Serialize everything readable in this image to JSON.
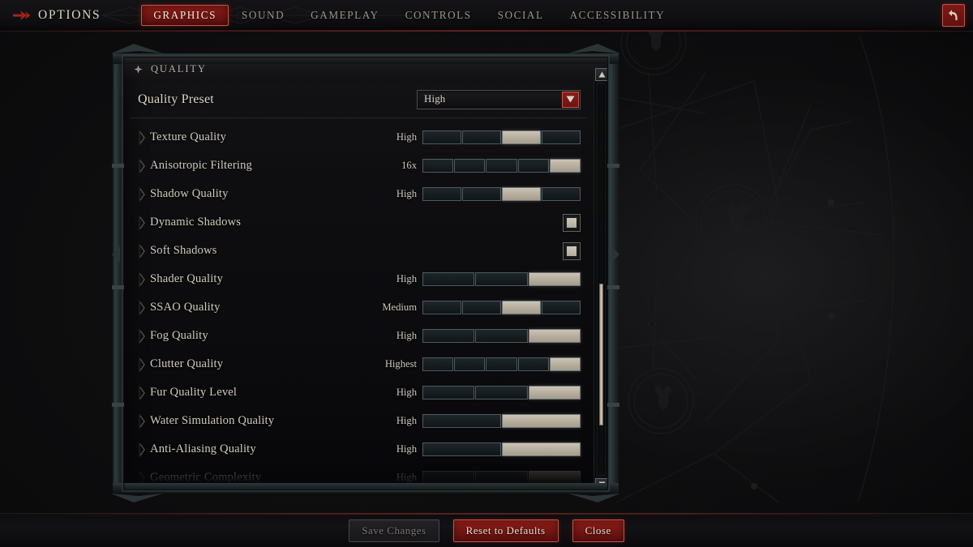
{
  "topbar": {
    "options_label": "OPTIONS",
    "options_icon": "right-arrow-icon",
    "back_icon": "back-arrow-icon",
    "tabs": [
      {
        "label": "GRAPHICS",
        "active": true
      },
      {
        "label": "SOUND",
        "active": false
      },
      {
        "label": "GAMEPLAY",
        "active": false
      },
      {
        "label": "CONTROLS",
        "active": false
      },
      {
        "label": "SOCIAL",
        "active": false
      },
      {
        "label": "ACCESSIBILITY",
        "active": false
      }
    ]
  },
  "panel": {
    "section_title": "QUALITY",
    "section_icon": "sparkle-diamond-icon",
    "preset": {
      "label": "Quality Preset",
      "value": "High",
      "dropdown_icon": "chevron-down-icon"
    },
    "settings": [
      {
        "name": "Texture Quality",
        "type": "slider",
        "value": "High",
        "segments": 4,
        "filled": 3,
        "dim": false
      },
      {
        "name": "Anisotropic Filtering",
        "type": "slider",
        "value": "16x",
        "segments": 5,
        "filled": 5,
        "dim": false
      },
      {
        "name": "Shadow Quality",
        "type": "slider",
        "value": "High",
        "segments": 4,
        "filled": 3,
        "dim": false
      },
      {
        "name": "Dynamic Shadows",
        "type": "checkbox",
        "value": "on",
        "checked": true,
        "dim": false
      },
      {
        "name": "Soft Shadows",
        "type": "checkbox",
        "value": "on",
        "checked": true,
        "dim": false
      },
      {
        "name": "Shader Quality",
        "type": "slider",
        "value": "High",
        "segments": 3,
        "filled": 3,
        "dim": false
      },
      {
        "name": "SSAO Quality",
        "type": "slider",
        "value": "Medium",
        "segments": 4,
        "filled": 3,
        "dim": false
      },
      {
        "name": "Fog Quality",
        "type": "slider",
        "value": "High",
        "segments": 3,
        "filled": 3,
        "dim": false
      },
      {
        "name": "Clutter Quality",
        "type": "slider",
        "value": "Highest",
        "segments": 5,
        "filled": 5,
        "dim": false
      },
      {
        "name": "Fur Quality Level",
        "type": "slider",
        "value": "High",
        "segments": 3,
        "filled": 3,
        "dim": false
      },
      {
        "name": "Water Simulation Quality",
        "type": "slider",
        "value": "High",
        "segments": 2,
        "filled": 2,
        "dim": false
      },
      {
        "name": "Anti-Aliasing Quality",
        "type": "slider",
        "value": "High",
        "segments": 2,
        "filled": 2,
        "dim": false
      },
      {
        "name": "Geometric Complexity",
        "type": "slider",
        "value": "High",
        "segments": 3,
        "filled": 3,
        "dim": true
      }
    ],
    "scrollbar": {
      "up_icon": "triangle-up-icon",
      "down_icon": "triangle-down-icon",
      "thumb_position_percent": 51
    }
  },
  "footer": {
    "buttons": [
      {
        "label": "Save Changes",
        "style": "disabled"
      },
      {
        "label": "Reset to Defaults",
        "style": "danger"
      },
      {
        "label": "Close",
        "style": "danger"
      }
    ]
  },
  "colors": {
    "accent_red": "#8e1d18",
    "accent_red_border": "#c2554a",
    "slider_fill": "#bdb5a4",
    "text_primary": "#ded6c8",
    "text_muted": "#9e968a"
  }
}
